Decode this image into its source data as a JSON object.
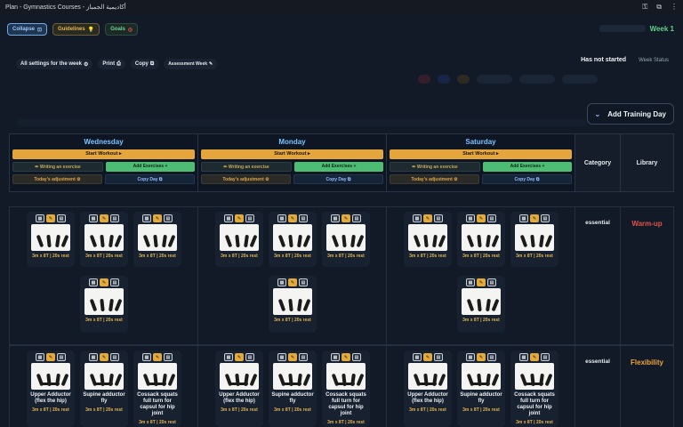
{
  "window": {
    "title": "Plan - Gymnastics Courses - أكاديمية الجمباز",
    "icons": [
      "key-icon",
      "extension-icon",
      "more-icon"
    ]
  },
  "toolbar": {
    "collapse_label": "Collapse",
    "guidelines_label": "Guidelines",
    "goals_label": "Goals",
    "week_label": "Week 1"
  },
  "settings": {
    "all_settings_label": "All settings for the week",
    "print_label": "Print",
    "copy_label": "Copy",
    "assessment_label": "Assessment Week"
  },
  "status": {
    "not_started": "Has not started",
    "week_status": "Week Status"
  },
  "add_training_day": "Add Training Day",
  "columns": {
    "category_header": "Category",
    "library_header": "Library"
  },
  "days": [
    {
      "name": "Wednesday",
      "start": "Start Workout",
      "writing": "Writing an exercise",
      "add": "Add Exercises",
      "adjust": "Today's adjustment",
      "copy": "Copy Day"
    },
    {
      "name": "Monday",
      "start": "Start Workout",
      "writing": "Writing an exercise",
      "add": "Add Exercises",
      "adjust": "Today's adjustment",
      "copy": "Copy Day"
    },
    {
      "name": "Saturday",
      "start": "Start Workout",
      "writing": "Writing an exercise",
      "add": "Add Exercises",
      "adjust": "Today's adjustment",
      "copy": "Copy Day"
    }
  ],
  "sections": [
    {
      "category": "essential",
      "library": "Warm-up",
      "library_color": "#e0524b"
    },
    {
      "category": "essential",
      "library": "Flexibility",
      "library_color": "#f0a53a"
    }
  ],
  "warmup_cards": {
    "reps": "3m x 8T | 20s rest"
  },
  "flex_cards": [
    {
      "name": "Upper Adductor (flex the hip)",
      "reps": "3m x 8T | 20s rest"
    },
    {
      "name": "Supine adductor fly",
      "reps": "3m x 8T | 20s rest"
    },
    {
      "name": "Cossack squats full turn for capsul for hip joint",
      "reps": "3m x 8T | 20s rest"
    }
  ]
}
